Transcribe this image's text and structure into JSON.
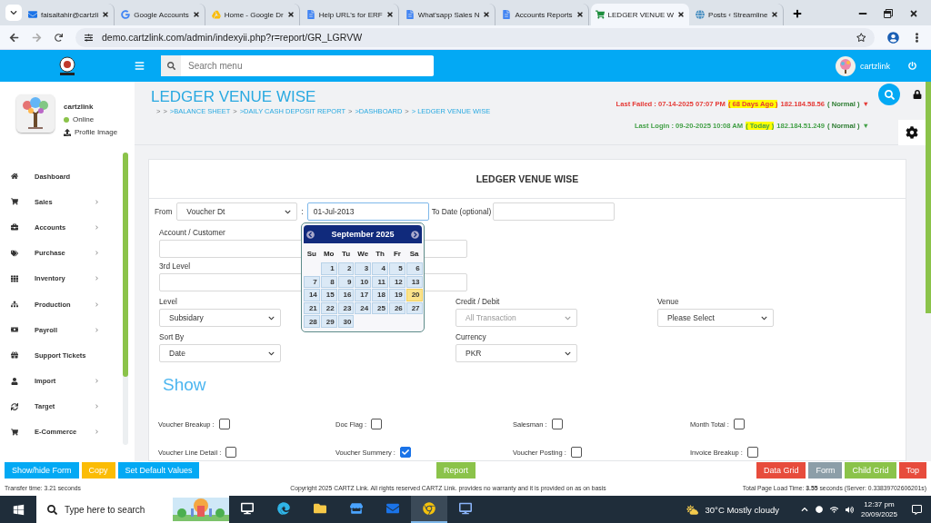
{
  "browser": {
    "tabs": [
      {
        "title": "faisaltahir@cartzli",
        "selected": false
      },
      {
        "title": "Google Accounts",
        "selected": false
      },
      {
        "title": "Home - Google Dr",
        "selected": false
      },
      {
        "title": "Help URL's for ERF",
        "selected": false
      },
      {
        "title": "What'sapp Sales N",
        "selected": false
      },
      {
        "title": "Accounts Reports",
        "selected": false
      },
      {
        "title": "LEDGER VENUE W",
        "selected": true
      },
      {
        "title": "Posts ‹ Streamline",
        "selected": false
      }
    ],
    "url": "demo.cartzlink.com/admin/indexyii.php?r=report/GR_LGRVW"
  },
  "header": {
    "search": {
      "placeholder": "Search menu"
    },
    "user": "cartzlink"
  },
  "sidebar": {
    "profile": {
      "name": "cartzlink",
      "status": "Online",
      "upload": "Profile Image"
    },
    "items": [
      {
        "label": "Dashboard",
        "has_submenu": false
      },
      {
        "label": "Sales",
        "has_submenu": true
      },
      {
        "label": "Accounts",
        "has_submenu": true
      },
      {
        "label": "Purchase",
        "has_submenu": true
      },
      {
        "label": "Inventory",
        "has_submenu": true
      },
      {
        "label": "Production",
        "has_submenu": true
      },
      {
        "label": "Payroll",
        "has_submenu": true
      },
      {
        "label": "Support Tickets",
        "has_submenu": false
      },
      {
        "label": "Import",
        "has_submenu": true
      },
      {
        "label": "Target",
        "has_submenu": true
      },
      {
        "label": "E-Commerce",
        "has_submenu": true
      }
    ]
  },
  "page": {
    "title": "LEDGER VENUE WISE",
    "breadcrumb": [
      {
        "label": ">",
        "kind": "separator"
      },
      {
        "label": ">",
        "kind": "separator"
      },
      {
        "label": ">BALANCE SHEET",
        "kind": "link"
      },
      {
        "label": ">",
        "kind": "separator"
      },
      {
        "label": ">DAILY CASH DEPOSIT REPORT",
        "kind": "link"
      },
      {
        "label": ">",
        "kind": "separator"
      },
      {
        "label": ">DASHBOARD",
        "kind": "link"
      },
      {
        "label": ">",
        "kind": "separator"
      },
      {
        "label": "> LEDGER VENUE WISE",
        "kind": "link"
      }
    ],
    "logins": [
      {
        "kind": "failed",
        "label": "Last Failed : 07-14-2025 07:07 PM",
        "ago": "( 68 Days Ago )",
        "ip": "182.184.58.56",
        "status": "( Normal )",
        "arrow": "▼"
      },
      {
        "kind": "success",
        "label": "Last Login : 09-20-2025 10:08 AM",
        "ago": "( Today )",
        "ip": "182.184.51.249",
        "status": "( Normal )",
        "arrow": "▼"
      }
    ]
  },
  "form": {
    "title": "LEDGER VENUE WISE",
    "from_label": "From",
    "from_select": "Voucher Dt",
    "colon": ":",
    "from_date": "01-Jul-2013",
    "to_label": "To Date (optional)",
    "account_label": "Account / Customer",
    "third_level_label": "3rd Level",
    "selects": [
      [
        {
          "label": "Level",
          "value": "Subsidary"
        },
        {
          "label": "Sort By",
          "value": "Date"
        }
      ],
      [
        {
          "label": "Credit / Debit",
          "placeholder": "All Transaction"
        },
        {
          "label": "Currency",
          "value": "PKR"
        }
      ],
      [
        {
          "label": "Venue",
          "value": "Please Select"
        }
      ]
    ],
    "show_heading": "Show",
    "options": [
      {
        "label": "Voucher Breakup :",
        "checked": false
      },
      {
        "label": "Doc Flag :",
        "checked": false
      },
      {
        "label": "Salesman :",
        "checked": false
      },
      {
        "label": "Month Total :",
        "checked": false
      },
      {
        "label": "Voucher Line Detail :",
        "checked": false
      },
      {
        "label": "Voucher Summery :",
        "checked": true
      },
      {
        "label": "Voucher Posting :",
        "checked": false
      },
      {
        "label": "Invoice Breakup :",
        "checked": false
      }
    ]
  },
  "calendar": {
    "month": "September 2025",
    "weekdays": [
      "Su",
      "Mo",
      "Tu",
      "We",
      "Th",
      "Fr",
      "Sa"
    ],
    "weeks": [
      {
        "days": [
          {
            "day": "1",
            "selected": false
          },
          {
            "day": "2",
            "selected": false
          },
          {
            "day": "3",
            "selected": false
          },
          {
            "day": "4",
            "selected": false
          },
          {
            "day": "5",
            "selected": false
          },
          {
            "day": "6",
            "selected": false
          }
        ]
      },
      {
        "days": [
          {
            "day": "7",
            "selected": false
          },
          {
            "day": "8",
            "selected": false
          },
          {
            "day": "9",
            "selected": false
          },
          {
            "day": "10",
            "selected": false
          },
          {
            "day": "11",
            "selected": false
          },
          {
            "day": "12",
            "selected": false
          },
          {
            "day": "13",
            "selected": false
          }
        ]
      },
      {
        "days": [
          {
            "day": "14",
            "selected": false
          },
          {
            "day": "15",
            "selected": false
          },
          {
            "day": "16",
            "selected": false
          },
          {
            "day": "17",
            "selected": false
          },
          {
            "day": "18",
            "selected": false
          },
          {
            "day": "19",
            "selected": false
          },
          {
            "day": "20",
            "selected": true
          }
        ]
      },
      {
        "days": [
          {
            "day": "21",
            "selected": false
          },
          {
            "day": "22",
            "selected": false
          },
          {
            "day": "23",
            "selected": false
          },
          {
            "day": "24",
            "selected": false
          },
          {
            "day": "25",
            "selected": false
          },
          {
            "day": "26",
            "selected": false
          },
          {
            "day": "27",
            "selected": false
          }
        ]
      },
      {
        "days": [
          {
            "day": "28",
            "selected": false
          },
          {
            "day": "29",
            "selected": false
          },
          {
            "day": "30",
            "selected": false
          }
        ]
      }
    ]
  },
  "actions": {
    "left": [
      {
        "label": "Show/hide Form",
        "color": "#03a9f4"
      },
      {
        "label": "Copy",
        "color": "#fbbc05"
      },
      {
        "label": "Set Default Values",
        "color": "#03a9f4"
      }
    ],
    "center": [
      {
        "label": "Report",
        "color": "#8bc34a"
      }
    ],
    "right": [
      {
        "label": "Data Grid",
        "color": "#e74c3c"
      },
      {
        "label": "Form",
        "color": "#8c9ea8"
      },
      {
        "label": "Child Grid",
        "color": "#8bc34a"
      },
      {
        "label": "Top",
        "color": "#e74c3c"
      }
    ]
  },
  "status_bar": {
    "transfer": "Transfer time: 3.21 seconds",
    "copyright": "Copyright 2025 CARTZ Link. All rights reserved CARTZ Link. provides no warranty and it is provided on as on basis",
    "load": "Total Page Load Time: **3.55** seconds (Server: 0.33839702606201s)"
  },
  "taskbar": {
    "search": {
      "placeholder": "Type here to search"
    },
    "apps": [
      {
        "selected": false
      },
      {
        "selected": false
      },
      {
        "selected": false
      },
      {
        "selected": false
      },
      {
        "selected": false
      },
      {
        "selected": true
      },
      {
        "selected": false
      }
    ],
    "weather": "30°C  Mostly cloudy",
    "time": "12:37 pm",
    "date": "20/09/2025"
  }
}
